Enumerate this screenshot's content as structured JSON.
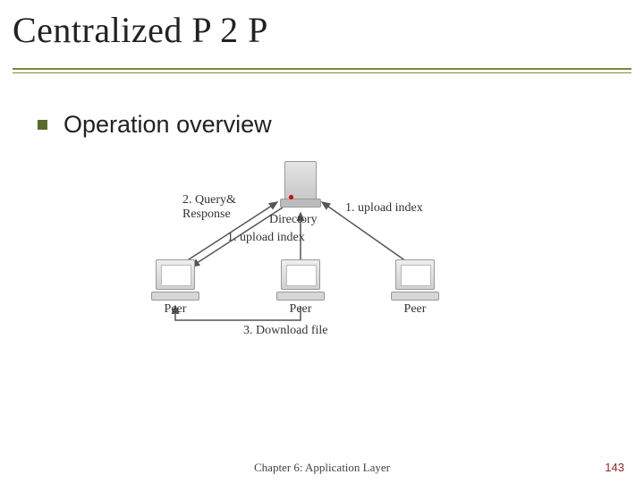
{
  "title": "Centralized P 2 P",
  "bullet": "Operation overview",
  "diagram": {
    "directory_label": "Directory",
    "peer_label": "Peer",
    "step_query_response": "2. Query&\nResponse",
    "step_upload_right": "1. upload index",
    "step_upload_mid": "1. upload index",
    "step_download": "3. Download file"
  },
  "footer": {
    "chapter": "Chapter 6: Application Layer",
    "page": "143"
  }
}
